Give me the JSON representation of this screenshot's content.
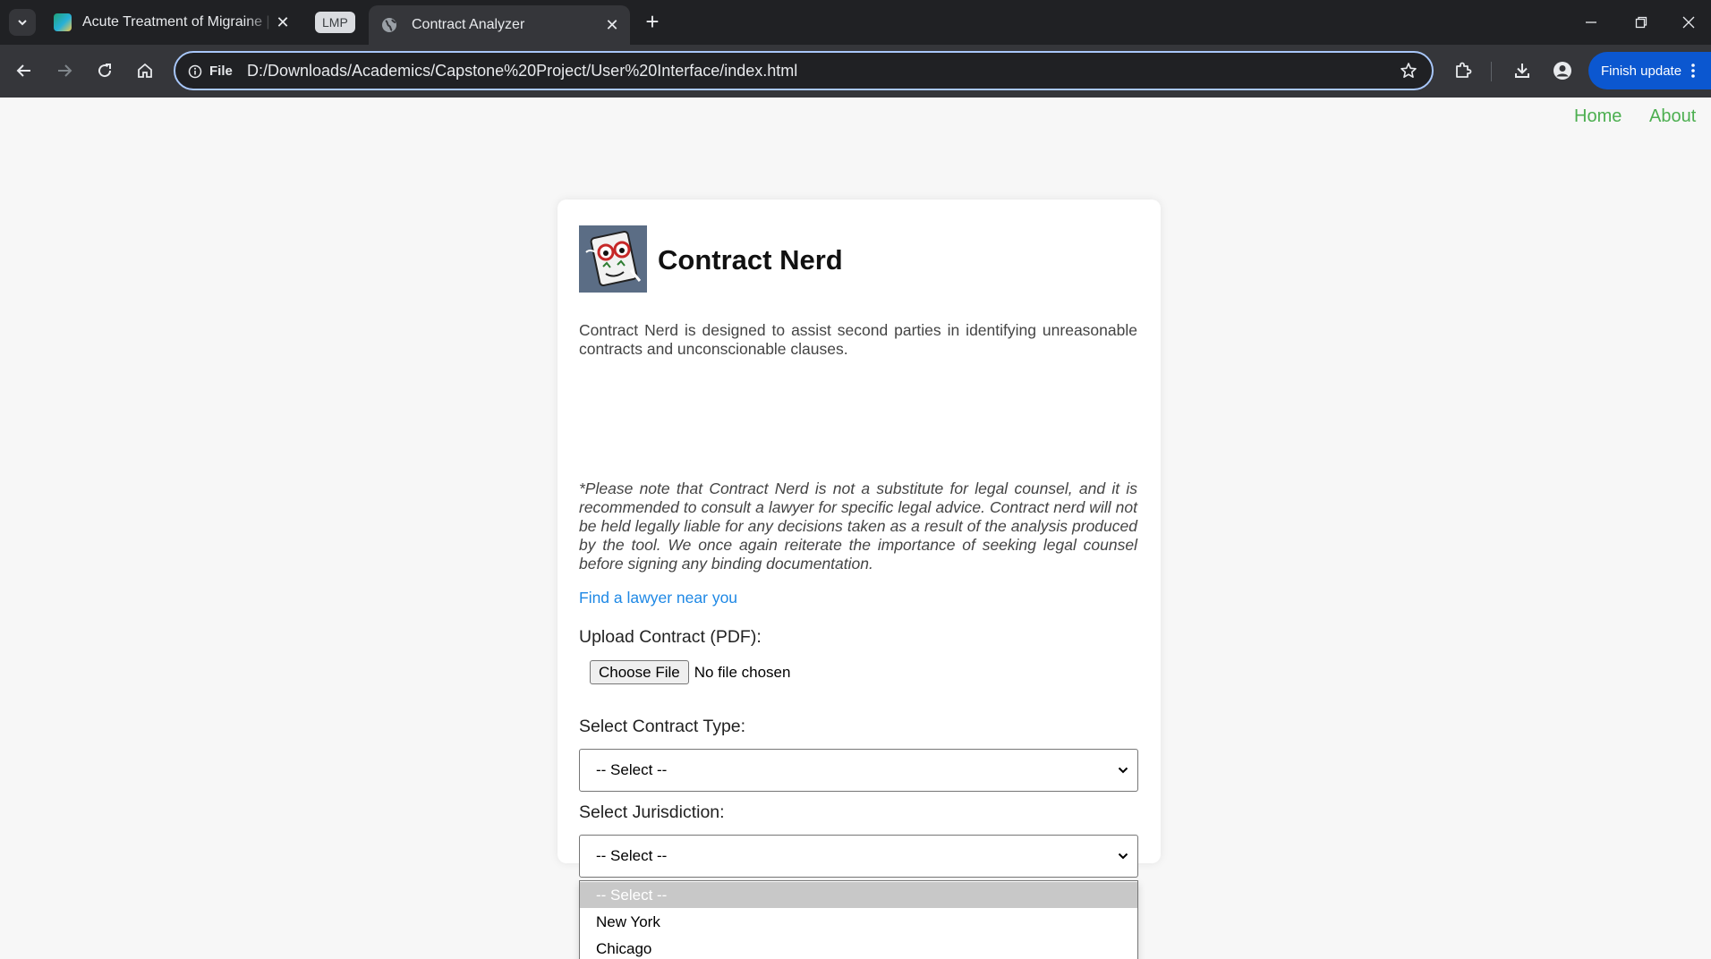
{
  "browser": {
    "tabs": [
      {
        "title": "Acute Treatment of Migraine | N",
        "active": false
      },
      {
        "title": "Contract Analyzer",
        "active": true
      }
    ],
    "tab_group_label": "LMP",
    "omnibox": {
      "scheme_label": "File",
      "url": "D:/Downloads/Academics/Capstone%20Project/User%20Interface/index.html"
    },
    "finish_update_label": "Finish update"
  },
  "nav": {
    "home": "Home",
    "about": "About"
  },
  "app": {
    "name": "Contract Nerd",
    "description": "Contract Nerd is designed to assist second parties in identifying unreasonable contracts and unconscionable clauses.",
    "disclaimer": "*Please note that Contract Nerd is not a substitute for legal counsel, and it is recommended to consult a lawyer for specific legal advice. Contract nerd will not be held legally liable for any decisions taken as a result of the analysis produced by the tool. We once again reiterate the importance of seeking legal counsel before signing any binding documentation.",
    "lawyer_link": "Find a lawyer near you",
    "upload": {
      "label": "Upload Contract (PDF):",
      "button": "Choose File",
      "status": "No file chosen"
    },
    "contract_type": {
      "label": "Select Contract Type:",
      "selected": "-- Select --"
    },
    "jurisdiction": {
      "label": "Select Jurisdiction:",
      "selected": "-- Select --",
      "options": [
        "-- Select --",
        "New York",
        "Chicago"
      ]
    }
  },
  "colors": {
    "nav_link": "#4caf50",
    "lawyer_link": "#1e88e5",
    "finish_update": "#0b57d0"
  }
}
